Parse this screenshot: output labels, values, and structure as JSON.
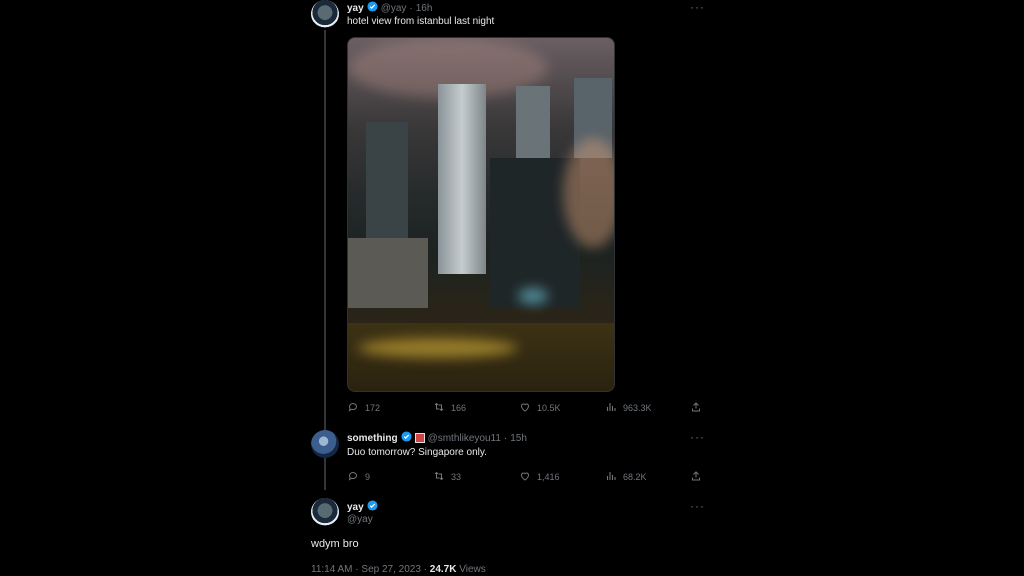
{
  "tweet1": {
    "name": "yay",
    "handle": "@yay",
    "time": "16h",
    "text": "hotel view from istanbul last night",
    "stats": {
      "replies": "172",
      "retweets": "166",
      "likes": "10.5K",
      "views": "963.3K"
    }
  },
  "tweet2": {
    "name": "something",
    "handle": "@smthlikeyou11",
    "time": "15h",
    "text": "Duo tomorrow? Singapore only.",
    "stats": {
      "replies": "9",
      "retweets": "33",
      "likes": "1,416",
      "views": "68.2K"
    }
  },
  "tweet3": {
    "name": "yay",
    "handle": "@yay",
    "text": "wdym bro",
    "timestamp": "11:14 AM · Sep 27, 2023 · ",
    "views_count": "24.7K",
    "views_label": " Views"
  },
  "separator": "·",
  "more_label": "···",
  "icons": {
    "verified": "verified-badge-icon",
    "reply": "reply-icon",
    "retweet": "retweet-icon",
    "like": "heart-icon",
    "views": "views-icon",
    "share": "share-icon"
  },
  "colors": {
    "verified": "#1d9bf0",
    "background": "#000000",
    "muted": "#71767b"
  }
}
